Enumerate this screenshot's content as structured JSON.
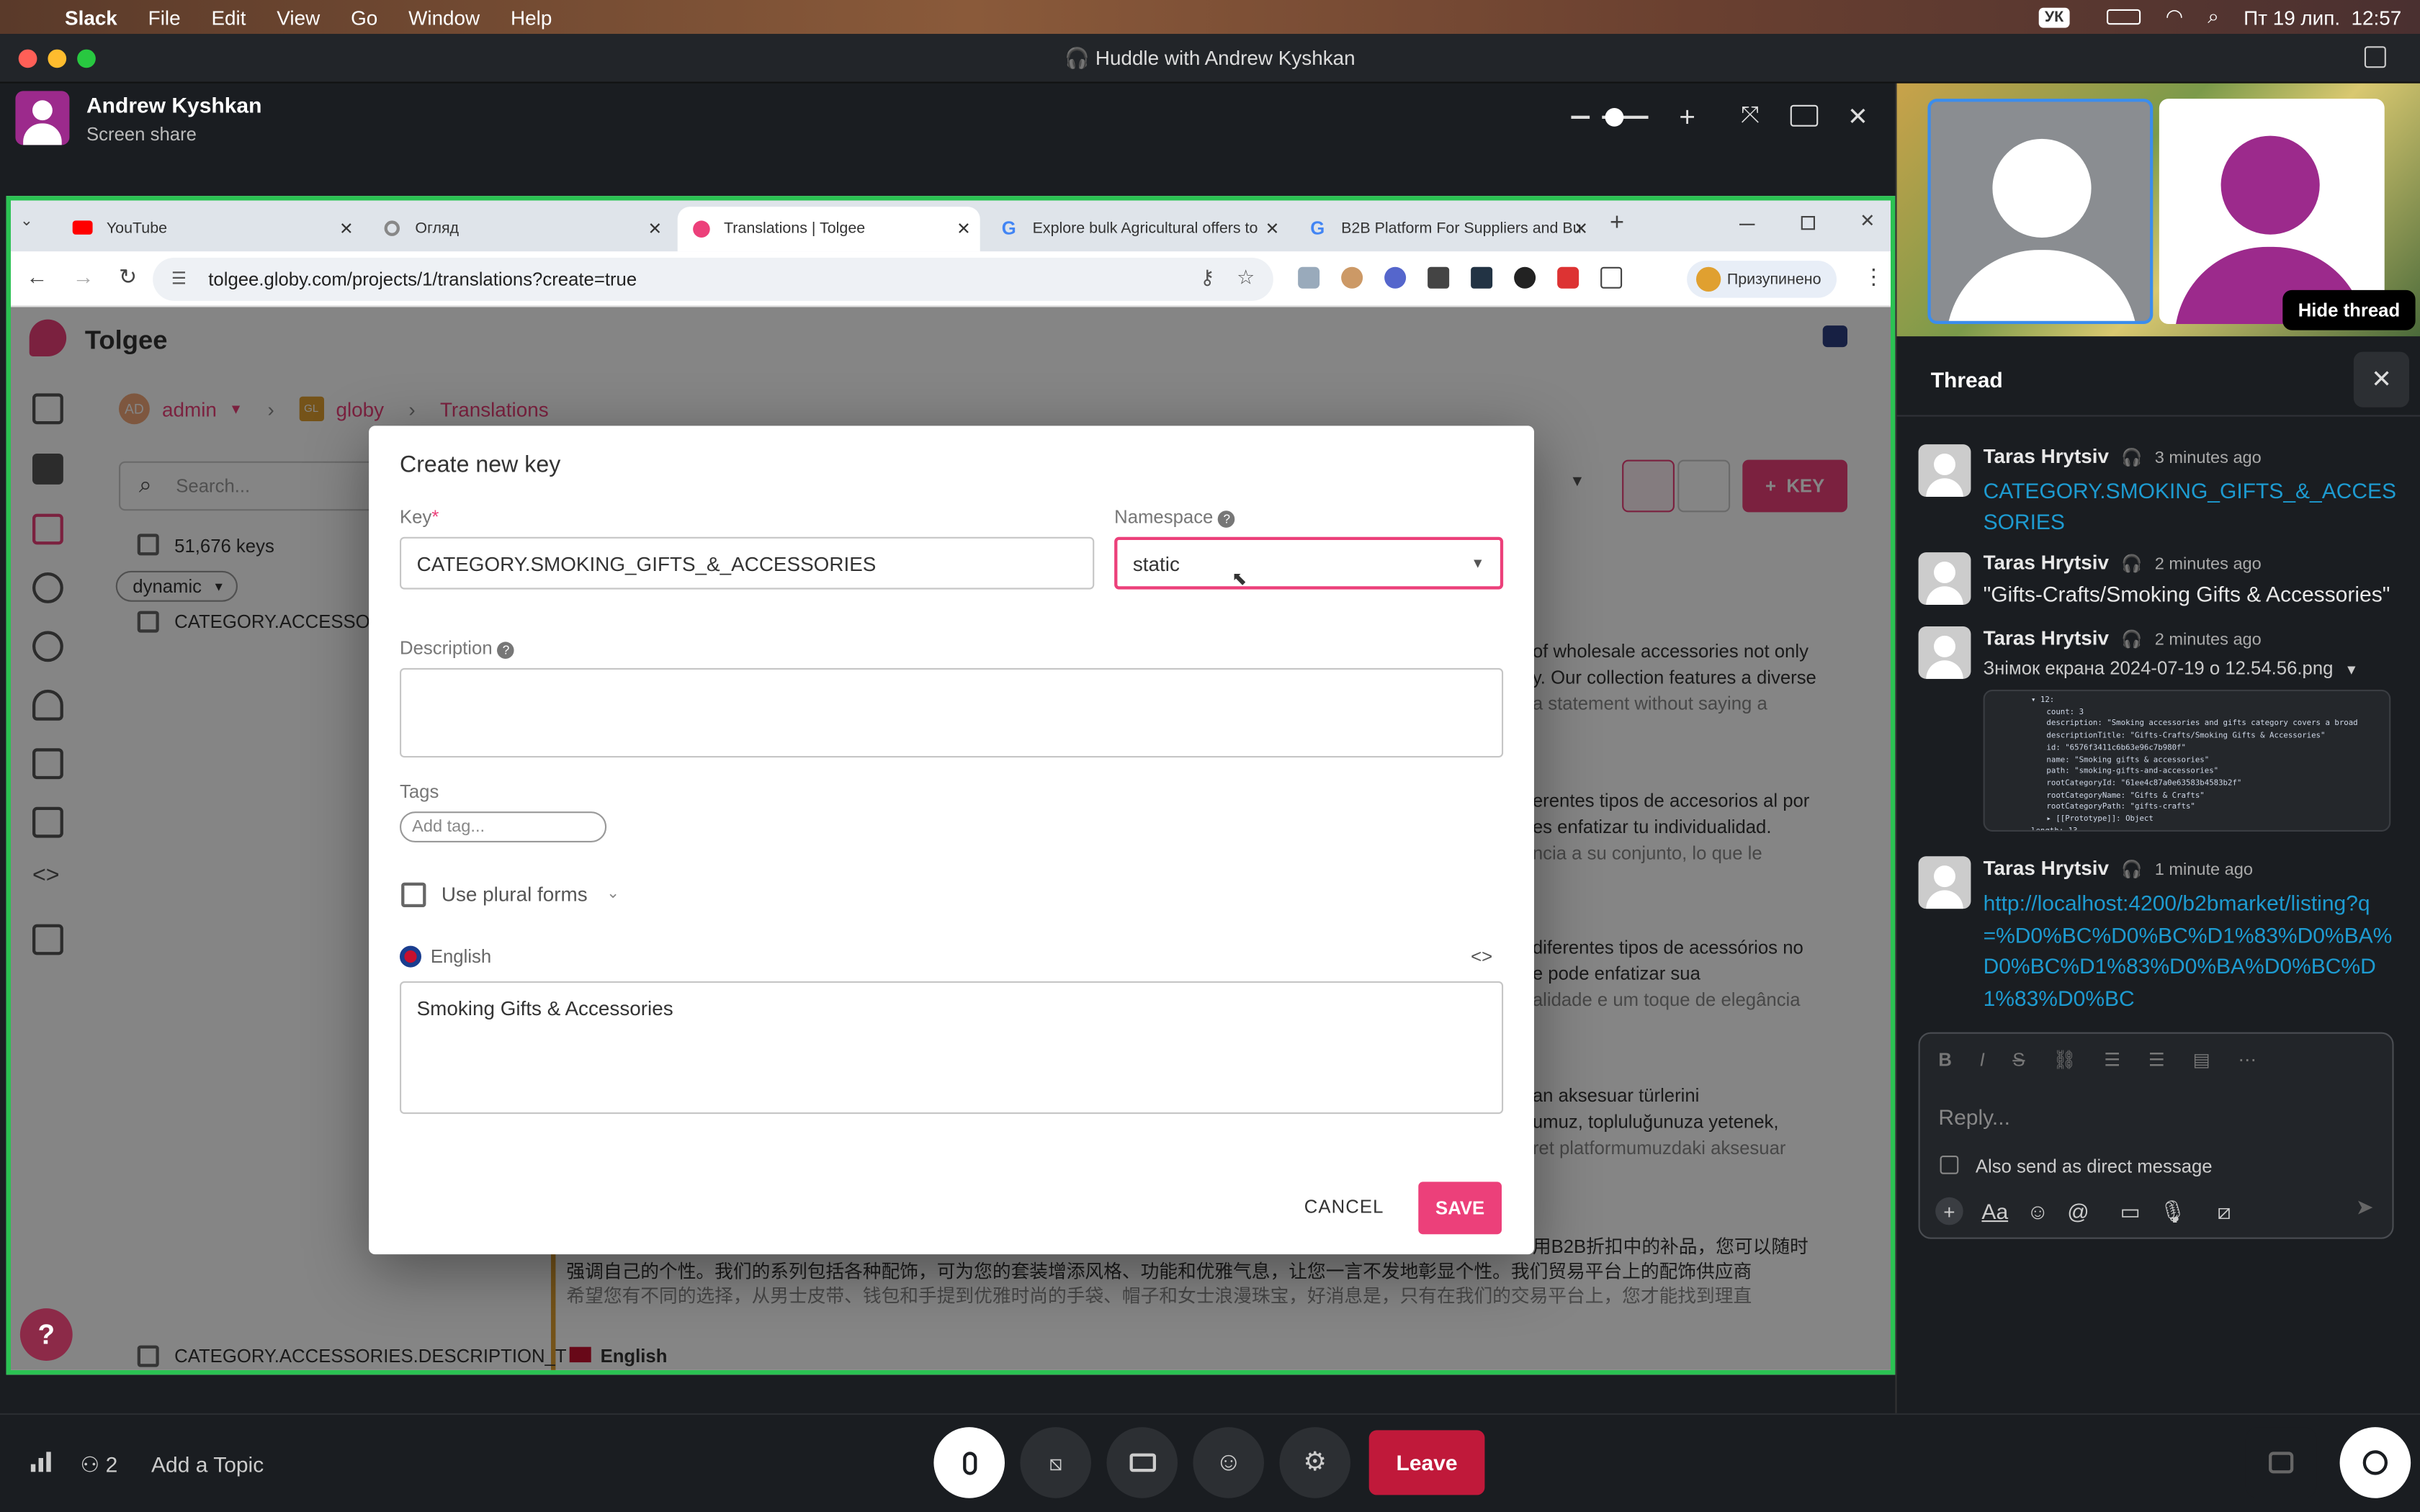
{
  "menubar": {
    "app": "Slack",
    "items": [
      "File",
      "Edit",
      "View",
      "Go",
      "Window",
      "Help"
    ],
    "lang": "УК",
    "datetime": "Пт 19 лип.  12:57"
  },
  "window": {
    "title": "Huddle with Andrew Kyshkan"
  },
  "presenter": {
    "name": "Andrew Kyshkan",
    "subtitle": "Screen share"
  },
  "browser": {
    "tabs": [
      "YouTube",
      "Огляд",
      "Translations | Tolgee",
      "Explore bulk Agricultural offers to",
      "B2B Platform For Suppliers and Bu"
    ],
    "url": "tolgee.globy.com/projects/1/translations?create=true",
    "paused_label": "Призупинено"
  },
  "tolgee": {
    "brand": "Tolgee",
    "breadcrumb": {
      "user": "admin",
      "user_initials": "AD",
      "project": "globy",
      "project_initials": "GL",
      "page": "Translations"
    },
    "search_placeholder": "Search...",
    "key_button": "KEY",
    "keys_count": "51,676 keys",
    "namespace_chip": "dynamic",
    "row1": "CATEGORY.ACCESSORI",
    "row_bottom": "CATEGORY.ACCESSORIES.DESCRIPTION_T",
    "row_bottom_lang": "English",
    "bg_text": [
      "of wholesale accessories not only",
      "y. Our collection features a diverse",
      "a statement without saying a",
      "erentes tipos de accesorios al por",
      "es enfatizar tu individualidad.",
      "ncia a su conjunto, lo que le",
      "diferentes tipos de acessórios no",
      "e pode enfatizar sua",
      "alidade e um toque de elegância",
      "an aksesuar türlerini",
      "umuz, topluluğunuza yetenek,",
      "ret platformumuzdaki aksesuar",
      "用B2B折扣中的补品，您可以随时",
      "强调自己的个性。我们的系列包括各种配饰，可为您的套装增添风格、功能和优雅气息，让您一言不发地彰显个性。我们贸易平台上的配饰供应商",
      "希望您有不同的选择，从男士皮带、钱包和手提到优雅时尚的手袋、帽子和女士浪漫珠宝，好消息是，只有在我们的交易平台上，您才能找到理直"
    ]
  },
  "modal": {
    "title": "Create new key",
    "key_label": "Key",
    "key_value": "CATEGORY.SMOKING_GIFTS_&_ACCESSORIES",
    "namespace_label": "Namespace",
    "namespace_value": "static",
    "description_label": "Description",
    "tags_label": "Tags",
    "tag_placeholder": "Add tag...",
    "plural_label": "Use plural forms",
    "language": "English",
    "translation_value": "Smoking Gifts & Accessories",
    "cancel": "CANCEL",
    "save": "SAVE"
  },
  "thread": {
    "hide_tooltip": "Hide thread",
    "title": "Thread",
    "messages": [
      {
        "author": "Taras Hrytsiv",
        "time": "3 minutes ago",
        "text": "CATEGORY.SMOKING_GIFTS_&_ACCESSORIES"
      },
      {
        "author": "Taras Hrytsiv",
        "time": "2 minutes ago",
        "text": "\"Gifts-Crafts/Smoking Gifts & Accessories\""
      },
      {
        "author": "Taras Hrytsiv",
        "time": "2 minutes ago",
        "text": "Знімок екрана 2024-07-19 о 12.54.56.png"
      },
      {
        "author": "Taras Hrytsiv",
        "time": "1 minute ago",
        "text": "http://localhost:4200/b2bmarket/listing?q=%D0%BC%D0%BC%D1%83%D0%BA%D0%BC%D1%83%D0%BA%D0%BC%D1%83%D0%BC"
      }
    ],
    "code_lines": [
      "▾ 12:",
      "count: 3",
      "description: \"Smoking accessories and gifts category covers a broad",
      "descriptionTitle: \"Gifts-Crafts/Smoking Gifts & Accessories\"",
      "id: \"6576f3411c6b63e96c7b980f\"",
      "name: \"Smoking gifts & accessories\"",
      "path: \"smoking-gifts-and-accessories\"",
      "rootCategoryId: \"61ee4c87a0e63583b4583b2f\"",
      "rootCategoryName: \"Gifts & Crafts\"",
      "rootCategoryPath: \"gifts-crafts\"",
      "▸ [[Prototype]]: Object",
      "length: 13"
    ],
    "reply_placeholder": "Reply...",
    "also_send": "Also send as direct message"
  },
  "huddle": {
    "participants": "2",
    "add_topic": "Add a Topic",
    "leave": "Leave"
  },
  "colors": {
    "accent": "#ec407a",
    "green_border": "#2bc253",
    "link": "#1d9bd1",
    "leave": "#c0193a"
  }
}
